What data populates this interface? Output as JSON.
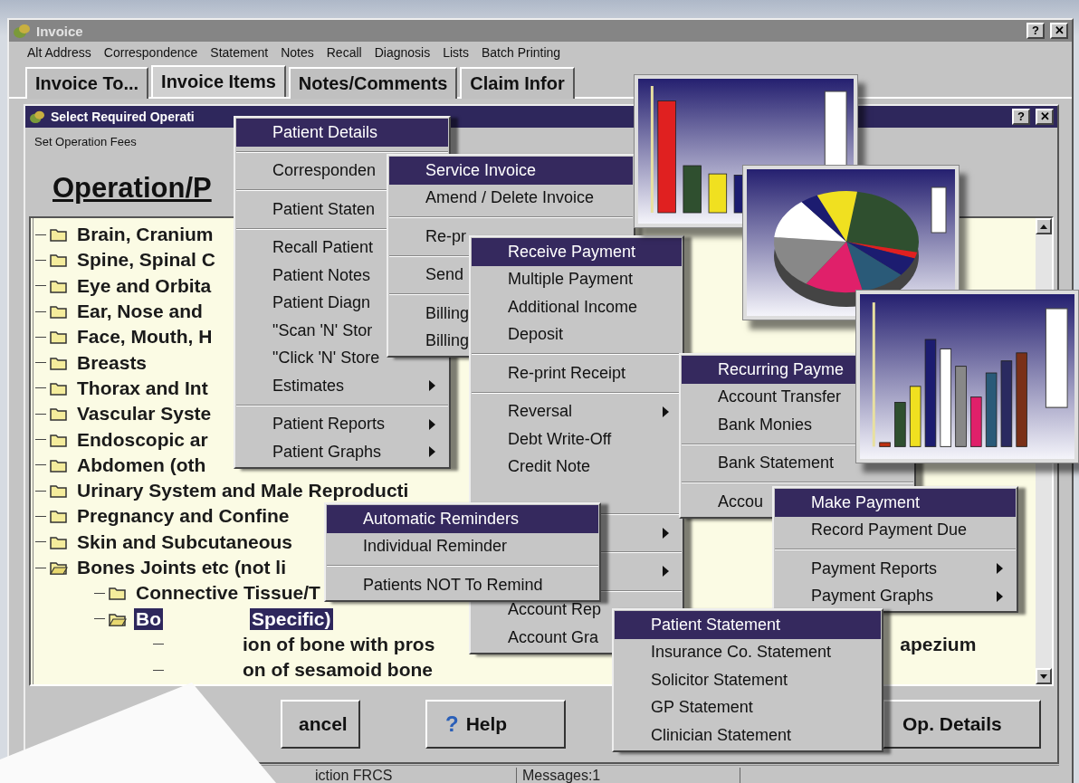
{
  "window": {
    "title": "Invoice",
    "controls": [
      "?",
      "✕"
    ]
  },
  "menu_bar": [
    "Alt Address",
    "Correspondence",
    "Statement",
    "Notes",
    "Recall",
    "Diagnosis",
    "Lists",
    "Batch Printing"
  ],
  "tabs": [
    {
      "label": "Invoice To...",
      "selected": false
    },
    {
      "label": "Invoice Items",
      "selected": true
    },
    {
      "label": "Notes/Comments",
      "selected": false
    },
    {
      "label": "Claim Infor",
      "selected": false
    }
  ],
  "dialog": {
    "title": "Select Required Operati",
    "controls": [
      "?",
      "✕"
    ],
    "menu": [
      "Set Operation Fees"
    ],
    "heading": "Operation/P",
    "tree": [
      {
        "label": "Brain, Cranium",
        "expanded": false,
        "selected": false
      },
      {
        "label": "Spine, Spinal C",
        "expanded": false,
        "selected": false
      },
      {
        "label": "Eye and Orbita",
        "expanded": false,
        "selected": false
      },
      {
        "label": "Ear, Nose and",
        "expanded": false,
        "selected": false
      },
      {
        "label": "Face, Mouth, H",
        "expanded": false,
        "selected": false
      },
      {
        "label": "Breasts",
        "expanded": false,
        "selected": false
      },
      {
        "label": "Thorax and Int",
        "expanded": false,
        "selected": false
      },
      {
        "label": "Vascular Syste",
        "expanded": false,
        "selected": false
      },
      {
        "label": "Endoscopic ar",
        "expanded": false,
        "selected": false
      },
      {
        "label": "Abdomen (oth",
        "expanded": false,
        "selected": false
      },
      {
        "label": "Urinary System and Male Reproducti",
        "expanded": false,
        "selected": false
      },
      {
        "label": "Pregnancy and Confine",
        "expanded": false,
        "selected": false
      },
      {
        "label": "Skin and Subcutaneous",
        "expanded": false,
        "selected": false
      },
      {
        "label": "Bones Joints etc (not li",
        "expanded": true,
        "selected": false,
        "children": [
          {
            "label": "Connective Tissue/T",
            "expanded": false,
            "selected": false
          },
          {
            "label": "Bo",
            "label_after": "Specific)",
            "expanded": true,
            "selected": true,
            "children": [
              {
                "label": "ion of bone with pros",
                "tail": "apezium"
              },
              {
                "label": "on of sesamoid bone"
              }
            ]
          }
        ]
      }
    ],
    "buttons": [
      {
        "label": "ancel"
      },
      {
        "icon": "?",
        "label": "Help"
      },
      {
        "label": "Op. Details"
      }
    ]
  },
  "status_bar": [
    "iction FRCS",
    "Messages:1"
  ],
  "menus": [
    {
      "items": [
        {
          "kind": "item",
          "label": "Patient Details",
          "selected": true
        },
        {
          "kind": "separator"
        },
        {
          "kind": "item",
          "label": "Corresponden",
          "selected": false
        },
        {
          "kind": "separator"
        },
        {
          "kind": "item",
          "label": "Patient Staten",
          "selected": false
        },
        {
          "kind": "separator"
        },
        {
          "kind": "item",
          "label": "Recall Patient",
          "selected": false
        },
        {
          "kind": "item",
          "label": "Patient Notes",
          "selected": false
        },
        {
          "kind": "item",
          "label": "Patient Diagn",
          "selected": false
        },
        {
          "kind": "item",
          "label": "\"Scan 'N' Stor",
          "selected": false
        },
        {
          "kind": "item",
          "label": "\"Click 'N' Store",
          "selected": false
        },
        {
          "kind": "item",
          "label": "Estimates",
          "selected": false,
          "submenu": true
        },
        {
          "kind": "separator"
        },
        {
          "kind": "item",
          "label": "Patient Reports",
          "selected": false,
          "submenu": true
        },
        {
          "kind": "item",
          "label": "Patient Graphs",
          "selected": false,
          "submenu": true
        }
      ]
    },
    {
      "items": [
        {
          "kind": "item",
          "label": "Service Invoice",
          "selected": true
        },
        {
          "kind": "item",
          "label": "Amend / Delete Invoice",
          "selected": false
        },
        {
          "kind": "separator"
        },
        {
          "kind": "item",
          "label": "Re-pr",
          "selected": false
        },
        {
          "kind": "separator"
        },
        {
          "kind": "item",
          "label": "Send",
          "selected": false
        },
        {
          "kind": "separator"
        },
        {
          "kind": "item",
          "label": "Billing",
          "selected": false
        },
        {
          "kind": "item",
          "label": "Billing",
          "selected": false
        }
      ]
    },
    {
      "items": [
        {
          "kind": "item",
          "label": "Receive Payment",
          "selected": true
        },
        {
          "kind": "item",
          "label": "Multiple Payment",
          "selected": false
        },
        {
          "kind": "item",
          "label": "Additional Income",
          "selected": false
        },
        {
          "kind": "item",
          "label": "Deposit",
          "selected": false
        },
        {
          "kind": "separator"
        },
        {
          "kind": "item",
          "label": "Re-print Receipt",
          "selected": false
        },
        {
          "kind": "separator"
        },
        {
          "kind": "item",
          "label": "Reversal",
          "selected": false,
          "submenu": true
        },
        {
          "kind": "item",
          "label": "Debt Write-Off",
          "selected": false
        },
        {
          "kind": "item",
          "label": "Credit Note",
          "selected": false
        },
        {
          "kind": "item",
          "selected": false
        },
        {
          "kind": "separator"
        },
        {
          "kind": "item",
          "selected": false,
          "submenu": true
        },
        {
          "kind": "separator"
        },
        {
          "kind": "item",
          "selected": false,
          "submenu": true
        },
        {
          "kind": "separator"
        },
        {
          "kind": "item",
          "label": "Account Rep",
          "selected": false
        },
        {
          "kind": "item",
          "label": "Account Gra",
          "selected": false
        }
      ]
    },
    {
      "items": [
        {
          "kind": "item",
          "label": "Automatic Reminders",
          "selected": true
        },
        {
          "kind": "item",
          "label": "Individual Reminder",
          "selected": false
        },
        {
          "kind": "separator"
        },
        {
          "kind": "item",
          "label": "Patients NOT To Remind",
          "selected": false
        }
      ]
    },
    {
      "items": [
        {
          "kind": "item",
          "label": "Recurring Payme",
          "selected": true
        },
        {
          "kind": "item",
          "label": "Account Transfer",
          "selected": false
        },
        {
          "kind": "item",
          "label": "Bank Monies",
          "selected": false
        },
        {
          "kind": "separator"
        },
        {
          "kind": "item",
          "label": "Bank Statement",
          "selected": false
        },
        {
          "kind": "separator"
        },
        {
          "kind": "item",
          "label": "Accou",
          "selected": false
        }
      ]
    },
    {
      "items": [
        {
          "kind": "item",
          "label": "Make Payment",
          "selected": true
        },
        {
          "kind": "item",
          "label": "Record Payment Due",
          "selected": false
        },
        {
          "kind": "separator"
        },
        {
          "kind": "item",
          "label": "Payment Reports",
          "selected": false,
          "submenu": true
        },
        {
          "kind": "item",
          "label": "Payment Graphs",
          "selected": false,
          "submenu": true
        }
      ]
    },
    {
      "items": [
        {
          "kind": "item",
          "label": "Patient Statement",
          "selected": true
        },
        {
          "kind": "item",
          "label": "Insurance Co. Statement",
          "selected": false
        },
        {
          "kind": "item",
          "label": "Solicitor Statement",
          "selected": false
        },
        {
          "kind": "item",
          "label": "GP Statement",
          "selected": false
        },
        {
          "kind": "item",
          "label": "Clinician Statement",
          "selected": false
        }
      ]
    }
  ],
  "chart_windows": [
    {
      "kind": "bar"
    },
    {
      "kind": "pie"
    },
    {
      "kind": "bar"
    }
  ]
}
